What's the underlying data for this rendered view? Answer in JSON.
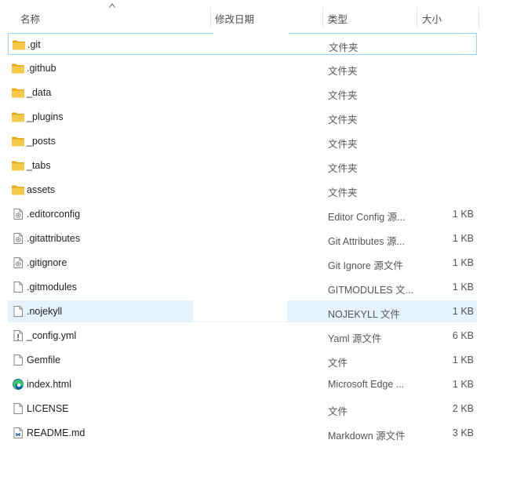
{
  "columns": {
    "name": "名称",
    "modified": "修改日期",
    "type": "类型",
    "size": "大小"
  },
  "files": [
    {
      "name": ".git",
      "type": "文件夹",
      "size": "",
      "icon": "folder-icon"
    },
    {
      "name": ".github",
      "type": "文件夹",
      "size": "",
      "icon": "folder-icon"
    },
    {
      "name": "_data",
      "type": "文件夹",
      "size": "",
      "icon": "folder-icon"
    },
    {
      "name": "_plugins",
      "type": "文件夹",
      "size": "",
      "icon": "folder-icon"
    },
    {
      "name": "_posts",
      "type": "文件夹",
      "size": "",
      "icon": "folder-icon"
    },
    {
      "name": "_tabs",
      "type": "文件夹",
      "size": "",
      "icon": "folder-icon"
    },
    {
      "name": "assets",
      "type": "文件夹",
      "size": "",
      "icon": "folder-icon"
    },
    {
      "name": ".editorconfig",
      "type": "Editor Config 源...",
      "size": "1 KB",
      "icon": "settings-file-icon"
    },
    {
      "name": ".gitattributes",
      "type": "Git Attributes 源...",
      "size": "1 KB",
      "icon": "settings-file-icon"
    },
    {
      "name": ".gitignore",
      "type": "Git Ignore 源文件",
      "size": "1 KB",
      "icon": "settings-file-icon"
    },
    {
      "name": ".gitmodules",
      "type": "GITMODULES 文...",
      "size": "1 KB",
      "icon": "blank-file-icon"
    },
    {
      "name": ".nojekyll",
      "type": "NOJEKYLL 文件",
      "size": "1 KB",
      "icon": "blank-file-icon"
    },
    {
      "name": "_config.yml",
      "type": "Yaml 源文件",
      "size": "6 KB",
      "icon": "yaml-file-icon"
    },
    {
      "name": "Gemfile",
      "type": "文件",
      "size": "1 KB",
      "icon": "blank-file-icon"
    },
    {
      "name": "index.html",
      "type": "Microsoft Edge ...",
      "size": "1 KB",
      "icon": "edge-icon"
    },
    {
      "name": "LICENSE",
      "type": "文件",
      "size": "2 KB",
      "icon": "blank-file-icon"
    },
    {
      "name": "README.md",
      "type": "Markdown 源文件",
      "size": "3 KB",
      "icon": "markdown-file-icon"
    }
  ],
  "colors": {
    "folder": "#f7c948",
    "folder_dark": "#e6a817",
    "focus_border": "#99d1ff",
    "hover_bg": "#e5f3ff",
    "edge_blue": "#0c59a4",
    "edge_green": "#3bc46a"
  }
}
